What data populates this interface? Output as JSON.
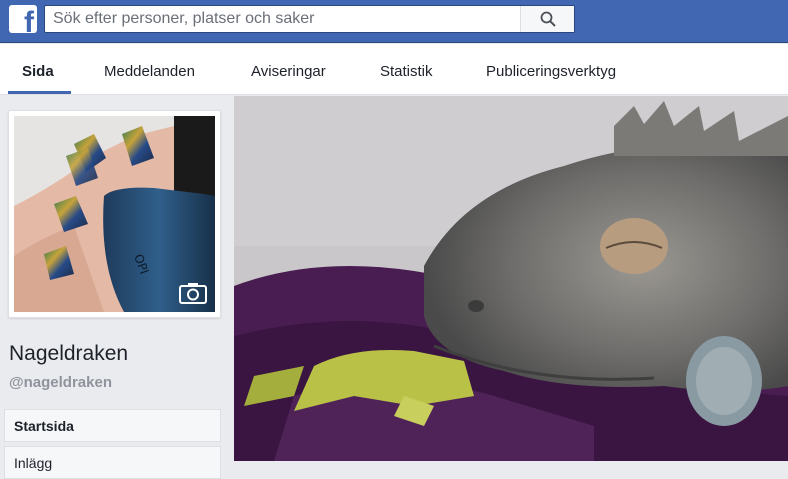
{
  "header": {
    "logo_letter": "f",
    "search_placeholder": "Sök efter personer, platser och saker"
  },
  "tabs": [
    {
      "label": "Sida",
      "active": true
    },
    {
      "label": "Meddelanden",
      "active": false
    },
    {
      "label": "Aviseringar",
      "active": false
    },
    {
      "label": "Statistik",
      "active": false
    },
    {
      "label": "Publiceringsverktyg",
      "active": false
    }
  ],
  "page": {
    "name": "Nageldraken",
    "handle": "@nageldraken"
  },
  "nav": [
    {
      "label": "Startsida",
      "active": true
    },
    {
      "label": "Inlägg",
      "active": false
    }
  ],
  "colors": {
    "brand": "#4267b2",
    "background": "#e9ebee"
  }
}
